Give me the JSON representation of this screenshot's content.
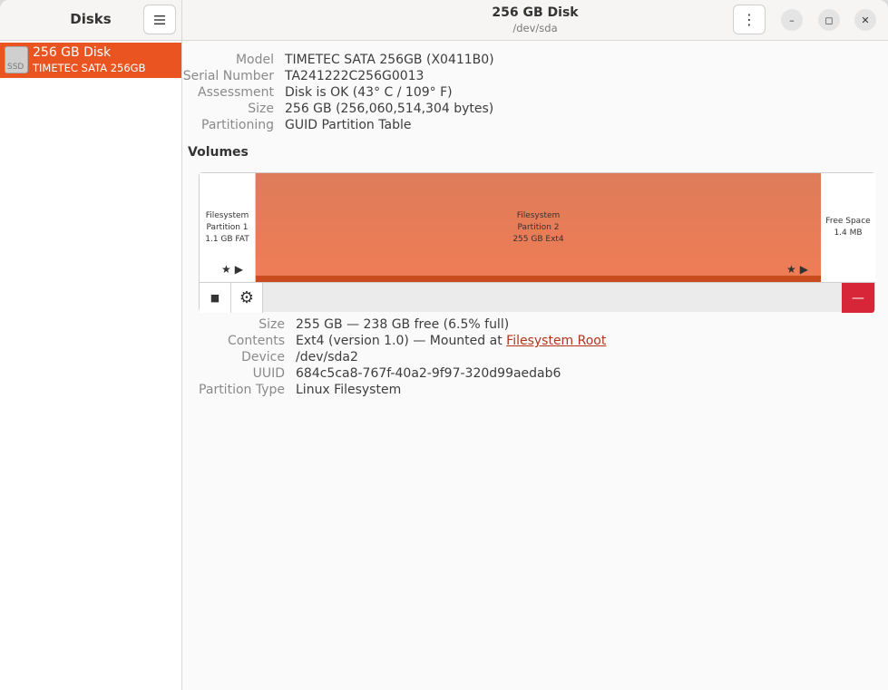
{
  "sidebar": {
    "title": "Disks",
    "menu_icon": "hamburger-icon",
    "disk": {
      "name": "256 GB Disk",
      "subtitle": "TIMETEC SATA 256GB",
      "icon_label": "SSD"
    }
  },
  "header": {
    "title": "256 GB Disk",
    "subtitle": "/dev/sda",
    "kebab_icon": "⋮",
    "minimize_icon": "–",
    "maximize_icon": "◻",
    "close_icon": "✕"
  },
  "disk_info": [
    {
      "label": "Model",
      "value": "TIMETEC SATA 256GB (X0411B0)"
    },
    {
      "label": "Serial Number",
      "value": "TA241222C256G0013"
    },
    {
      "label": "Assessment",
      "value": "Disk is OK (43° C / 109° F)"
    },
    {
      "label": "Size",
      "value": "256 GB (256,060,514,304 bytes)"
    },
    {
      "label": "Partitioning",
      "value": "GUID Partition Table"
    }
  ],
  "volumes": {
    "title": "Volumes",
    "partitions": [
      {
        "line1": "Filesystem",
        "line2": "Partition 1",
        "line3": "1.1 GB FAT",
        "marks": "★▶"
      },
      {
        "line1": "Filesystem",
        "line2": "Partition 2",
        "line3": "255 GB Ext4",
        "marks": "★▶"
      },
      {
        "line1": "Free Space",
        "line2": "1.4 MB"
      }
    ],
    "toolbar": {
      "stop_icon": "■",
      "gear_icon": "⚙",
      "delete_icon": "—"
    }
  },
  "partition_info": [
    {
      "label": "Size",
      "value": "255 GB — 238 GB free (6.5% full)"
    },
    {
      "label": "Contents",
      "value": "Ext4 (version 1.0) — Mounted at ",
      "link": "Filesystem Root"
    },
    {
      "label": "Device",
      "value": "/dev/sda2"
    },
    {
      "label": "UUID",
      "value": "684c5ca8-767f-40a2-9f97-320d99aedab6"
    },
    {
      "label": "Partition Type",
      "value": "Linux Filesystem"
    }
  ],
  "colors": {
    "accent": "#e95420",
    "danger": "#d72637",
    "link": "#b3341b"
  }
}
